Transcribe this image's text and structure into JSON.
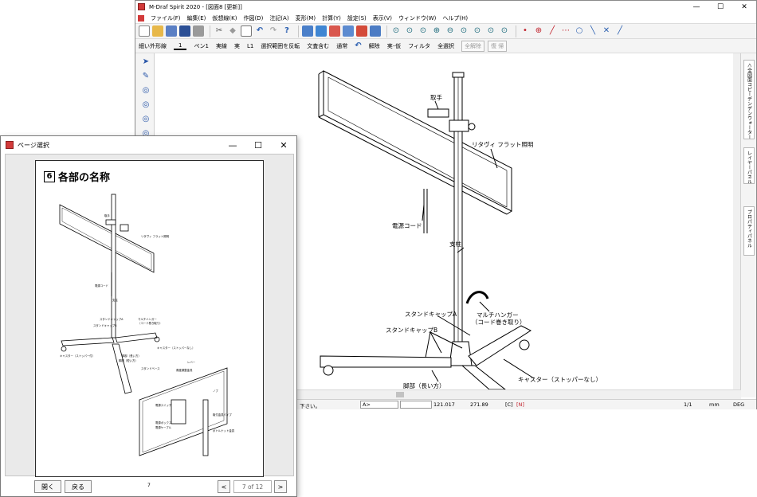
{
  "main_window": {
    "title": "M-Draf Spirit 2020 - [図面8 [更新]]",
    "window_buttons": [
      "—",
      "☐",
      "✕"
    ],
    "menu": [
      "ファイル(F)",
      "編集(E)",
      "仮想線(K)",
      "作図(D)",
      "注記(A)",
      "変形(M)",
      "計算(Y)",
      "設定(S)",
      "表示(V)",
      "ウィンドウ(W)",
      "ヘルプ(H)"
    ],
    "toolbar_icons": [
      "new-icon",
      "open-icon",
      "save-as-icon",
      "save-icon",
      "print-icon",
      "cut-icon",
      "eraser-icon",
      "square-icon",
      "undo-icon",
      "redo-icon",
      "help-icon",
      "layers-icon",
      "folder-icon",
      "palette-icon",
      "monitor-icon",
      "toolbox-icon",
      "grid-icon",
      "zoom-icons",
      "point-icon",
      "target-icon",
      "line-icon",
      "select-icon",
      "circle-icon",
      "slash-icon",
      "cross-icon",
      "diagonal-icon"
    ],
    "toolbar2": {
      "line_type": "細い外形線",
      "line_width": "1",
      "pen": "ペン1",
      "solid": "実線",
      "solid2": "実",
      "layer": "L1",
      "invert_selection": "選択範囲を反転",
      "include_text": "文査含む",
      "mode": "通常",
      "release": "解除",
      "real_temp": "実･仮",
      "filter": "フィルタ",
      "select_all": "全選択",
      "release_all": "全解除",
      "restore": "復 帰"
    },
    "right_tabs": [
      "＜全図面コピーデンデンウォーター",
      "レイヤーパネル",
      "プロパティパネル"
    ],
    "statusbar": {
      "left_text": "下さい。",
      "input_value": "A>",
      "x_value": "121.017",
      "y_value": "271.89",
      "c_flag": "[C]",
      "n_flag": "[N]",
      "page_ratio": "1/1",
      "unit_mm": "mm",
      "unit_deg": "DEG"
    }
  },
  "drawing": {
    "labels": {
      "handle": "取手",
      "flat_light": "リタヴィ フラット照明",
      "power_cord": "電源コード",
      "column": "支柱",
      "stand_cap_a": "スタンドキャップA",
      "stand_cap_b": "スタンドキャップB",
      "multi_hanger": "マルチハンガー",
      "multi_hanger_sub": "（コード巻き取り）",
      "caster": "キャスター（ストッパーなし）",
      "leg_long": "脚部（長い方）"
    }
  },
  "page_dialog": {
    "title": "ページ選択",
    "window_buttons": [
      "—",
      "☐",
      "✕"
    ],
    "page_number_label": "6",
    "page_heading": "各部の名称",
    "page_footer_number": "7",
    "open_button": "開く",
    "back_button": "戻る",
    "prev": "<",
    "next": ">",
    "page_indicator": "7 of 12",
    "mini_labels": [
      "取手",
      "リタヴィ フラット照明",
      "電源コード",
      "支柱",
      "スタンドキャップA",
      "スタンドキャップB",
      "マルチハンガー",
      "（コード巻き取り）",
      "キャスター（ストッパーなし）",
      "脚部（長い方）",
      "キャスター（ストッパー付）",
      "脚部（短い方）",
      "スタンドベース",
      "レバー",
      "角度調整金具",
      "電源スイッチ",
      "電源ボックス",
      "電源ケーブル",
      "ノブ",
      "取付金具パイプ",
      "ボトルナット金具"
    ]
  }
}
